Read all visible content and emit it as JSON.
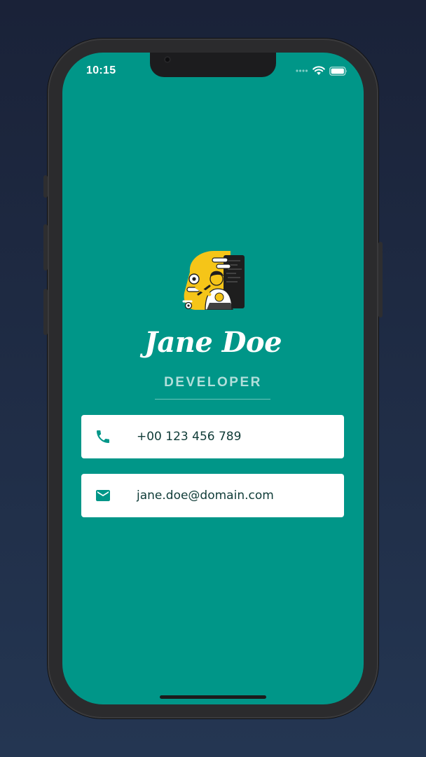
{
  "status_bar": {
    "time": "10:15"
  },
  "profile": {
    "name": "Jane Doe",
    "title": "DEVELOPER"
  },
  "contacts": {
    "phone": "+00 123 456 789",
    "email": "jane.doe@domain.com"
  },
  "icons": {
    "phone": "phone-icon",
    "email": "mail-icon",
    "wifi": "wifi-icon",
    "battery": "battery-icon",
    "signal": "signal-icon"
  },
  "colors": {
    "background_top": "#1a2238",
    "background_bottom": "#243652",
    "screen": "#009688",
    "accent_icon": "#009688",
    "subtitle": "#b2dfdb",
    "card": "#ffffff",
    "card_text": "#0f3b37",
    "avatar_yellow": "#f5c518"
  }
}
